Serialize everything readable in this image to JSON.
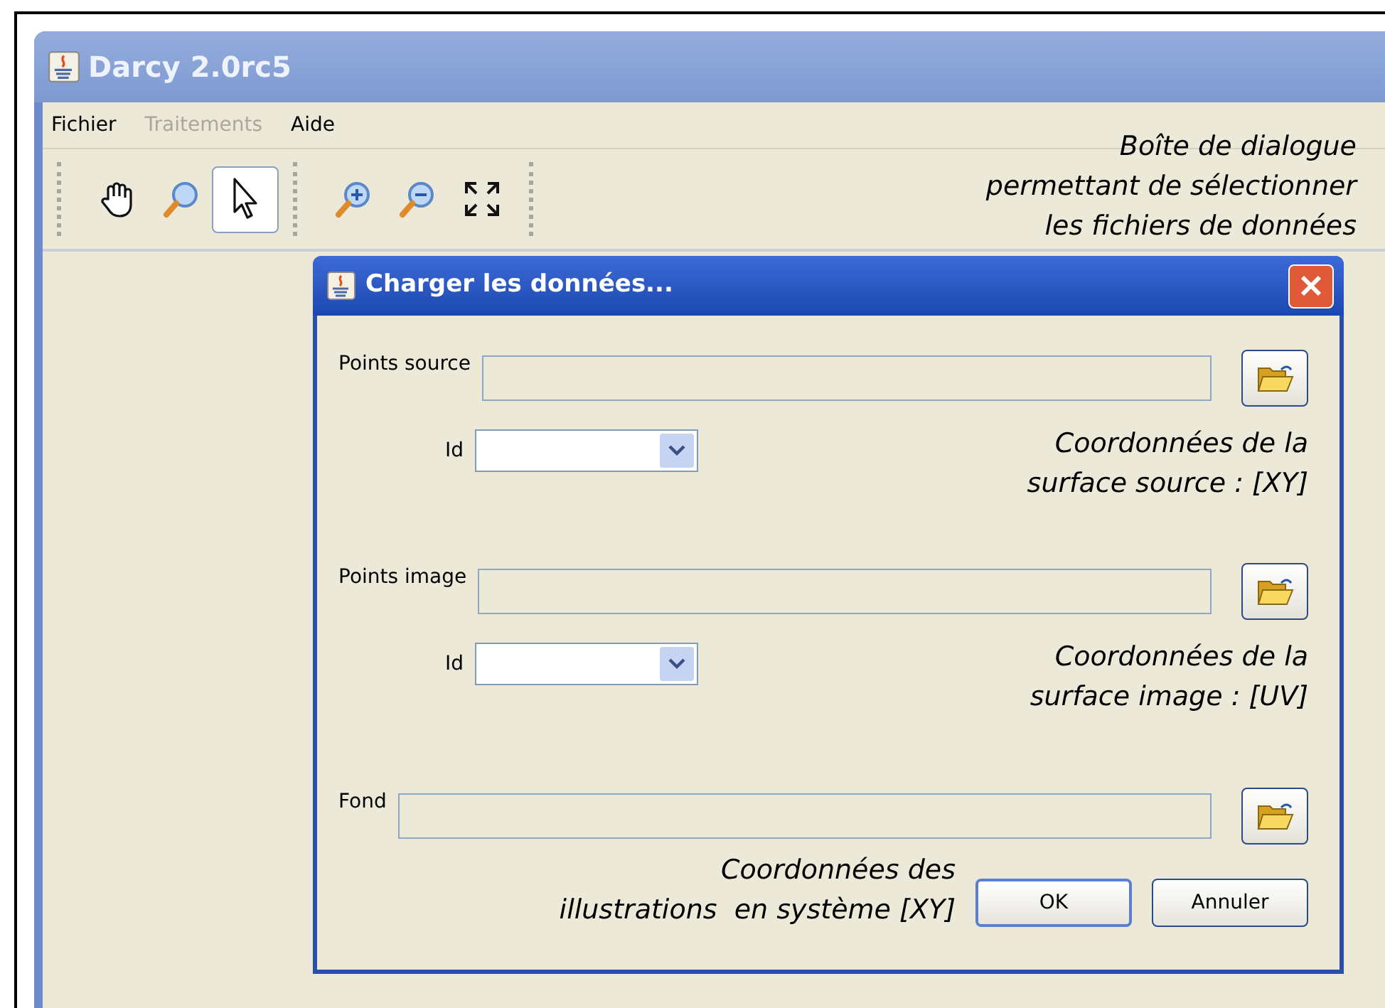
{
  "window": {
    "title": "Darcy 2.0rc5"
  },
  "menu": [
    {
      "label": "Fichier",
      "disabled": false
    },
    {
      "label": "Traitements",
      "disabled": true
    },
    {
      "label": "Aide",
      "disabled": false
    }
  ],
  "toolbar": [
    [
      {
        "kind": "hand",
        "selected": false
      },
      {
        "kind": "zoom",
        "selected": false
      },
      {
        "kind": "pointer",
        "selected": true
      }
    ],
    [
      {
        "kind": "zoom-in",
        "selected": false
      },
      {
        "kind": "zoom-out",
        "selected": false
      },
      {
        "kind": "fit",
        "selected": false
      }
    ]
  ],
  "note": [
    "Boîte de dialogue",
    "permettant de sélectionner",
    "les fichiers de données"
  ],
  "dialog": {
    "title": "Charger les données...",
    "rows": [
      {
        "label": "Points source",
        "id_label": "Id",
        "note": [
          "Coordonnées de la",
          "surface source : [XY]"
        ]
      },
      {
        "label": "Points image",
        "id_label": "Id",
        "note": [
          "Coordonnées de la",
          "surface image : [UV]"
        ]
      },
      {
        "label": "Fond"
      }
    ],
    "bottom_note": [
      "Coordonnées des",
      "illustrations  en système [XY]"
    ],
    "buttons": [
      "OK",
      "Annuler"
    ]
  }
}
